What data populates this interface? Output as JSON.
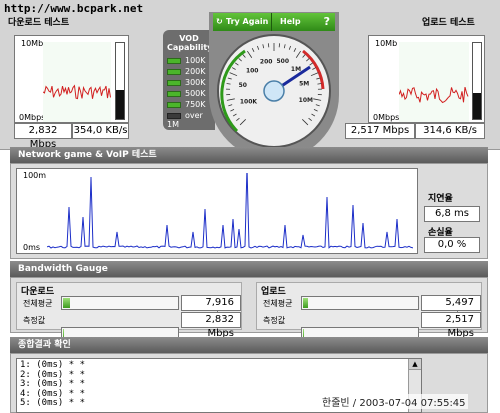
{
  "url_label": "http://www.bcpark.net",
  "download": {
    "title": "다운로드 테스트",
    "top_label": "10Mb",
    "bottom_label": "0Mbps",
    "speed": "2,832 Mbps",
    "rate": "354,0 KB/s",
    "level": 0.38
  },
  "upload": {
    "title": "업로드 테스트",
    "top_label": "10Mb",
    "bottom_label": "0Mbps",
    "speed": "2,517 Mbps",
    "rate": "314,6 KB/s",
    "level": 0.34
  },
  "vod": {
    "title_line1": "VOD",
    "title_line2": "Capability",
    "levels": [
      "100K",
      "200K",
      "300K",
      "500K",
      "750K",
      "over 1M"
    ]
  },
  "dial": {
    "try_again": "Try Again",
    "help": "Help",
    "help_glyph": "?",
    "tick_labels": [
      "100K",
      "50",
      "100",
      "200",
      "500",
      "1M",
      "5M",
      "10M"
    ]
  },
  "network": {
    "title": "Network game & VoIP 테스트",
    "top_label": "100m",
    "bottom_label": "0ms",
    "latency_label": "지연율",
    "latency_value": "6,8 ms",
    "loss_label": "손실율",
    "loss_value": "0,0 %"
  },
  "bandwidth": {
    "title": "Bandwidth Gauge",
    "download": {
      "title": "다운로드",
      "overall_label": "전체평균",
      "overall_value": "7,916 Mbps",
      "overall_level": 0.08,
      "measured_label": "측정값",
      "measured_value": "2,832 Mbps",
      "measured_level": 0.03
    },
    "upload": {
      "title": "업로드",
      "overall_label": "전체평균",
      "overall_value": "5,497 Mbps",
      "overall_level": 0.06,
      "measured_label": "측정값",
      "measured_value": "2,517 Mbps",
      "measured_level": 0.03
    }
  },
  "results": {
    "title": "종합결과 확인",
    "lines": [
      "1: (0ms) * *",
      "2: (0ms) * *",
      "3: (0ms) * *",
      "4: (0ms) * *",
      "5: (0ms) * *"
    ]
  },
  "footer": "한줄빈 / 2003-07-04 07:55:45",
  "colors": {
    "accent_green": "#4bb52a",
    "graph_red": "#d21f1f",
    "graph_blue": "#1c2ec8",
    "needle": "#1a2a9c"
  }
}
